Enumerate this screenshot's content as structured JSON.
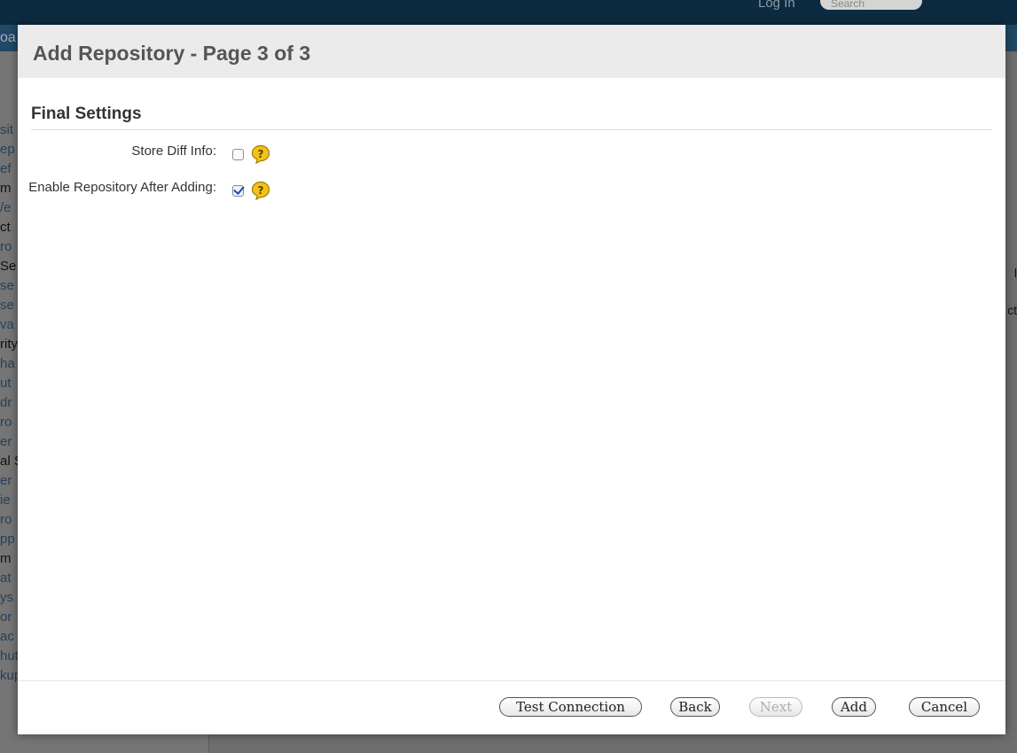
{
  "background": {
    "top_bar": {
      "login_label": "Log In",
      "search_placeholder": "Search"
    },
    "sub_bar_text": "oa",
    "sidebar_fragments": [
      "sit",
      "ep",
      "ef",
      "m",
      "/e",
      "ct",
      "ro",
      "Se",
      "se",
      "se",
      "va",
      "rity",
      "ha",
      "ut",
      "dr",
      "ro",
      "er",
      "al S",
      "er",
      "ie",
      "ro",
      "pp",
      "m",
      "at",
      "ys",
      "or",
      "ac",
      "hutdown",
      "kuping"
    ],
    "right_fragments": [
      "l",
      "ct"
    ]
  },
  "dialog": {
    "title": "Add Repository - Page 3 of 3",
    "section_title": "Final Settings",
    "fields": [
      {
        "label": "Store Diff Info:",
        "checked": false,
        "help_icon": "help-question-icon"
      },
      {
        "label": "Enable Repository After Adding:",
        "checked": true,
        "help_icon": "help-question-icon"
      }
    ],
    "buttons": {
      "test_connection": "Test Connection",
      "back": "Back",
      "next": "Next",
      "add": "Add",
      "cancel": "Cancel"
    },
    "colors": {
      "help_icon_fill": "#f2c316",
      "header_bg": "#ebebeb",
      "title_color": "#555555"
    }
  }
}
